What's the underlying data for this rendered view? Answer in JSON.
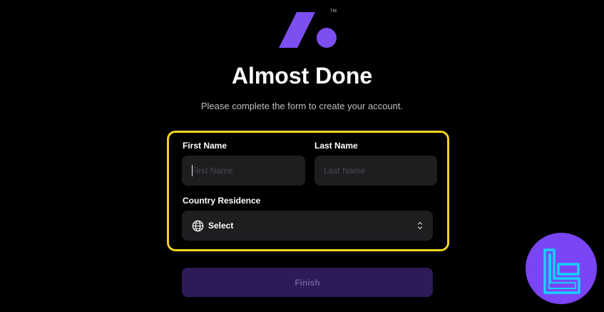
{
  "header": {
    "logo_icon": "brand-logo-icon",
    "trademark": "TM",
    "title": "Almost Done",
    "subtitle": "Please complete the form to create your account."
  },
  "form": {
    "first_name": {
      "label": "First Name",
      "value": "",
      "placeholder": "First Name"
    },
    "last_name": {
      "label": "Last Name",
      "value": "",
      "placeholder": "Last Name"
    },
    "country": {
      "label": "Country Residence",
      "selected": "Select",
      "icon": "globe-icon"
    },
    "finish_label": "Finish"
  },
  "badge": {
    "icon": "tradingfinder-badge-icon"
  },
  "colors": {
    "background": "#000000",
    "accent": "#7b4ff0",
    "highlight": "#f5d21e",
    "field_bg": "#1e1e21",
    "button_bg": "#2d1a57",
    "button_text": "#6f5d96",
    "badge_bg": "#7a45f5",
    "badge_icon": "#18d0ff"
  }
}
